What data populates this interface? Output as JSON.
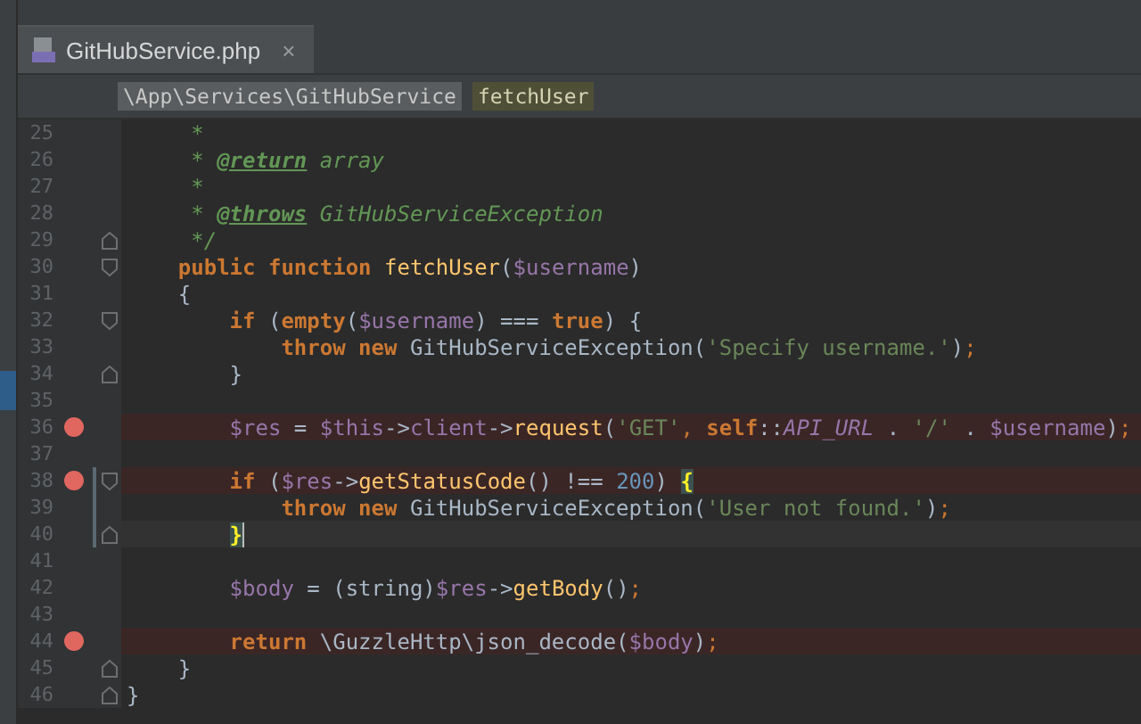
{
  "tabs": [
    {
      "label": "GitHubService.php",
      "close": "×",
      "selected": true
    }
  ],
  "breadcrumbs": [
    {
      "label": "\\App\\Services\\GitHubService",
      "kind": "class"
    },
    {
      "label": "fetchUser",
      "kind": "method"
    }
  ],
  "lines": [
    {
      "number": "25",
      "breakpoint": false,
      "current": false,
      "changed": false,
      "fold_start": false,
      "fold_end": false,
      "tokens": [
        {
          "kind": "doc",
          "text": "     *"
        }
      ]
    },
    {
      "number": "26",
      "breakpoint": false,
      "current": false,
      "changed": false,
      "fold_start": false,
      "fold_end": false,
      "tokens": [
        {
          "kind": "doc",
          "text": "     * "
        },
        {
          "kind": "doctag",
          "text": "@return"
        },
        {
          "kind": "doc",
          "text": " array"
        }
      ]
    },
    {
      "number": "27",
      "breakpoint": false,
      "current": false,
      "changed": false,
      "fold_start": false,
      "fold_end": false,
      "tokens": [
        {
          "kind": "doc",
          "text": "     *"
        }
      ]
    },
    {
      "number": "28",
      "breakpoint": false,
      "current": false,
      "changed": false,
      "fold_start": false,
      "fold_end": false,
      "tokens": [
        {
          "kind": "doc",
          "text": "     * "
        },
        {
          "kind": "doctag",
          "text": "@throws"
        },
        {
          "kind": "doc",
          "text": " GitHubServiceException"
        }
      ]
    },
    {
      "number": "29",
      "breakpoint": false,
      "current": false,
      "changed": false,
      "fold_start": false,
      "fold_end": true,
      "tokens": [
        {
          "kind": "doc",
          "text": "     */"
        }
      ]
    },
    {
      "number": "30",
      "breakpoint": false,
      "current": false,
      "changed": false,
      "fold_start": true,
      "fold_end": false,
      "tokens": [
        {
          "kind": "kw",
          "text": "    public function "
        },
        {
          "kind": "fn",
          "text": "fetchUser"
        },
        {
          "kind": "plain",
          "text": "("
        },
        {
          "kind": "var",
          "text": "$username"
        },
        {
          "kind": "plain",
          "text": ")"
        }
      ]
    },
    {
      "number": "31",
      "breakpoint": false,
      "current": false,
      "changed": false,
      "fold_start": false,
      "fold_end": false,
      "tokens": [
        {
          "kind": "plain",
          "text": "    {"
        }
      ]
    },
    {
      "number": "32",
      "breakpoint": false,
      "current": false,
      "changed": false,
      "fold_start": true,
      "fold_end": false,
      "tokens": [
        {
          "kind": "kw",
          "text": "        if "
        },
        {
          "kind": "plain",
          "text": "("
        },
        {
          "kind": "kw",
          "text": "empty"
        },
        {
          "kind": "plain",
          "text": "("
        },
        {
          "kind": "var",
          "text": "$username"
        },
        {
          "kind": "plain",
          "text": ") === "
        },
        {
          "kind": "kw",
          "text": "true"
        },
        {
          "kind": "plain",
          "text": ") {"
        }
      ]
    },
    {
      "number": "33",
      "breakpoint": false,
      "current": false,
      "changed": false,
      "fold_start": false,
      "fold_end": false,
      "tokens": [
        {
          "kind": "kw",
          "text": "            throw new "
        },
        {
          "kind": "plain",
          "text": "GitHubServiceException("
        },
        {
          "kind": "str",
          "text": "'Specify username.'"
        },
        {
          "kind": "plain",
          "text": ")"
        },
        {
          "kind": "punct",
          "text": ";"
        }
      ]
    },
    {
      "number": "34",
      "breakpoint": false,
      "current": false,
      "changed": false,
      "fold_start": false,
      "fold_end": true,
      "tokens": [
        {
          "kind": "plain",
          "text": "        }"
        }
      ]
    },
    {
      "number": "35",
      "breakpoint": false,
      "current": false,
      "changed": false,
      "fold_start": false,
      "fold_end": false
    },
    {
      "number": "36",
      "breakpoint": true,
      "current": false,
      "changed": false,
      "fold_start": false,
      "fold_end": false,
      "tokens": [
        {
          "kind": "var",
          "text": "        $res"
        },
        {
          "kind": "plain",
          "text": " = "
        },
        {
          "kind": "var",
          "text": "$this"
        },
        {
          "kind": "plain",
          "text": "->"
        },
        {
          "kind": "var",
          "text": "client"
        },
        {
          "kind": "plain",
          "text": "->"
        },
        {
          "kind": "fn",
          "text": "request"
        },
        {
          "kind": "plain",
          "text": "("
        },
        {
          "kind": "str",
          "text": "'GET'"
        },
        {
          "kind": "punct",
          "text": ", "
        },
        {
          "kind": "kw",
          "text": "self"
        },
        {
          "kind": "plain",
          "text": "::"
        },
        {
          "kind": "const",
          "text": "API_URL"
        },
        {
          "kind": "plain",
          "text": " . "
        },
        {
          "kind": "str",
          "text": "'/'"
        },
        {
          "kind": "plain",
          "text": " . "
        },
        {
          "kind": "var",
          "text": "$username"
        },
        {
          "kind": "plain",
          "text": ")"
        },
        {
          "kind": "punct",
          "text": ";"
        }
      ]
    },
    {
      "number": "37",
      "breakpoint": false,
      "current": false,
      "changed": false,
      "fold_start": false,
      "fold_end": false
    },
    {
      "number": "38",
      "breakpoint": true,
      "current": false,
      "changed": true,
      "fold_start": true,
      "fold_end": false,
      "tokens": [
        {
          "kind": "kw",
          "text": "        if "
        },
        {
          "kind": "plain",
          "text": "("
        },
        {
          "kind": "var",
          "text": "$res"
        },
        {
          "kind": "plain",
          "text": "->"
        },
        {
          "kind": "fn",
          "text": "getStatusCode"
        },
        {
          "kind": "plain",
          "text": "() !== "
        },
        {
          "kind": "num",
          "text": "200"
        },
        {
          "kind": "plain",
          "text": ") "
        },
        {
          "kind": "brace",
          "text": "{"
        }
      ]
    },
    {
      "number": "39",
      "breakpoint": false,
      "current": false,
      "changed": true,
      "fold_start": false,
      "fold_end": false,
      "tokens": [
        {
          "kind": "kw",
          "text": "            throw new "
        },
        {
          "kind": "plain",
          "text": "GitHubServiceException("
        },
        {
          "kind": "str",
          "text": "'User not found.'"
        },
        {
          "kind": "plain",
          "text": ")"
        },
        {
          "kind": "punct",
          "text": ";"
        }
      ]
    },
    {
      "number": "40",
      "breakpoint": false,
      "current": true,
      "changed": true,
      "fold_start": false,
      "fold_end": true,
      "tokens": [
        {
          "kind": "brace",
          "text": "        }"
        }
      ]
    },
    {
      "number": "41",
      "breakpoint": false,
      "current": false,
      "changed": false,
      "fold_start": false,
      "fold_end": false
    },
    {
      "number": "42",
      "breakpoint": false,
      "current": false,
      "changed": false,
      "fold_start": false,
      "fold_end": false,
      "tokens": [
        {
          "kind": "var",
          "text": "        $body"
        },
        {
          "kind": "plain",
          "text": " = (string)"
        },
        {
          "kind": "var",
          "text": "$res"
        },
        {
          "kind": "plain",
          "text": "->"
        },
        {
          "kind": "fn",
          "text": "getBody"
        },
        {
          "kind": "plain",
          "text": "()"
        },
        {
          "kind": "punct",
          "text": ";"
        }
      ]
    },
    {
      "number": "43",
      "breakpoint": false,
      "current": false,
      "changed": false,
      "fold_start": false,
      "fold_end": false
    },
    {
      "number": "44",
      "breakpoint": true,
      "current": false,
      "changed": false,
      "fold_start": false,
      "fold_end": false,
      "tokens": [
        {
          "kind": "kw",
          "text": "        return "
        },
        {
          "kind": "plain",
          "text": "\\GuzzleHttp\\json_decode("
        },
        {
          "kind": "var",
          "text": "$body"
        },
        {
          "kind": "plain",
          "text": ")"
        },
        {
          "kind": "punct",
          "text": ";"
        }
      ]
    },
    {
      "number": "45",
      "breakpoint": false,
      "current": false,
      "changed": false,
      "fold_start": false,
      "fold_end": true,
      "tokens": [
        {
          "kind": "plain",
          "text": "    }"
        }
      ]
    },
    {
      "number": "46",
      "breakpoint": false,
      "current": false,
      "changed": false,
      "fold_start": false,
      "fold_end": true,
      "tokens": [
        {
          "kind": "plain",
          "text": "}"
        }
      ]
    }
  ]
}
